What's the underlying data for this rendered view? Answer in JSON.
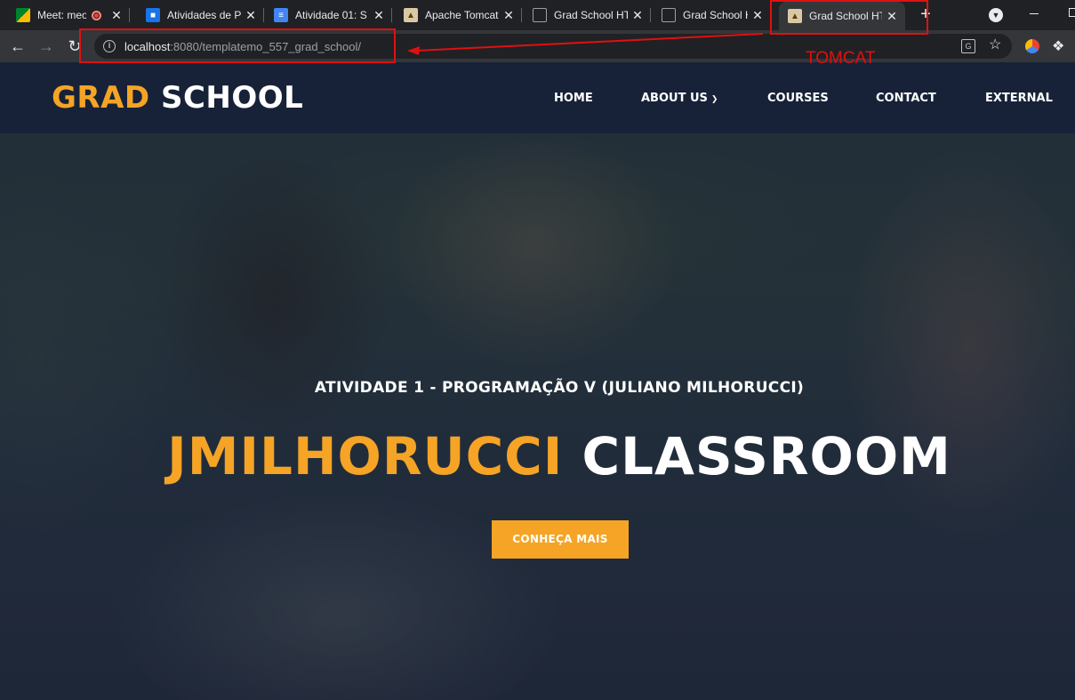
{
  "browser": {
    "tabs": [
      {
        "title": "Meet: meo",
        "icon": "meet-icon",
        "recording": true
      },
      {
        "title": "Atividades de P",
        "icon": "classroom-icon"
      },
      {
        "title": "Atividade 01: S",
        "icon": "docs-icon"
      },
      {
        "title": "Apache Tomcat",
        "icon": "tomcat-icon"
      },
      {
        "title": "Grad School HT",
        "icon": "globe-icon"
      },
      {
        "title": "Grad School HT",
        "icon": "globe-icon"
      },
      {
        "title": "Grad School HT",
        "icon": "tomcat-icon",
        "active": true
      }
    ],
    "new_tab_symbol": "+",
    "close_symbol": "✕",
    "address": {
      "host": "localhost",
      "path": ":8080/templatemo_557_grad_school/"
    }
  },
  "annotation": {
    "label": "TOMCAT",
    "color": "#e01010"
  },
  "site": {
    "logo": {
      "accent": "GRAD",
      "rest": "SCHOOL"
    },
    "nav": [
      {
        "label": "HOME"
      },
      {
        "label": "ABOUT US",
        "has_dropdown": true
      },
      {
        "label": "COURSES"
      },
      {
        "label": "CONTACT"
      },
      {
        "label": "EXTERNAL"
      }
    ],
    "hero": {
      "subtitle": "ATIVIDADE 1 - PROGRAMAÇÃO V (JULIANO MILHORUCCI)",
      "title_accent": "JMILHORUCCI",
      "title_rest": "CLASSROOM",
      "cta_label": "CONHEÇA MAIS"
    },
    "colors": {
      "accent": "#f5a425",
      "header_bg": "#172238"
    }
  }
}
